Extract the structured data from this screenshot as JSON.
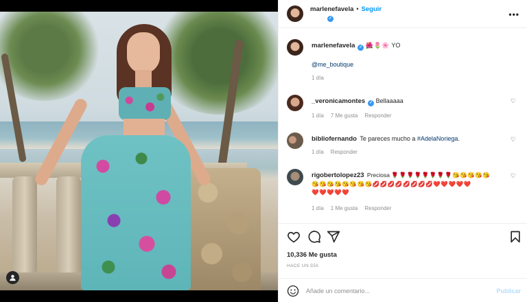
{
  "post": {
    "author": "marlenefavela",
    "follow_label": "Seguir",
    "dot": "•",
    "more": "•••"
  },
  "caption": {
    "user": "marlenefavela",
    "emojis": "🌺🌷🌸",
    "text": "YO",
    "mention": "@me_boutique",
    "time": "1 día"
  },
  "comments": [
    {
      "user": "_veronicamontes",
      "verified": true,
      "text": "Bellaaaaa",
      "time": "1 día",
      "likes": "7 Me gusta",
      "reply": "Responder"
    },
    {
      "user": "bibliofernando",
      "verified": false,
      "text": "Te pareces mucho a ",
      "hashtag": "#AdelaNoriega",
      "end": ".",
      "time": "1 día",
      "reply": "Responder"
    },
    {
      "user": "rigobertolopez23",
      "verified": false,
      "text": "Preciosa",
      "emojis_line1": "🌹🌹🌹🌹🌹🌹🌹🌹😘😘😘😘😘",
      "emojis_line2": "😘😘😘😘😘😘😘😘💋💋💋💋💋💋💋💋❤️❤️❤️❤️❤️",
      "emojis_line3": "❤️❤️❤️❤️❤️",
      "time": "1 día",
      "likes": "1 Me gusta",
      "reply": "Responder"
    }
  ],
  "stats": {
    "likes": "10,336 Me gusta",
    "time": "HACE UN DÍA"
  },
  "composer": {
    "placeholder": "Añade un comentario...",
    "publish": "Publicar"
  },
  "icons": {
    "like": "heart-icon",
    "comment": "comment-icon",
    "share": "share-icon",
    "save": "bookmark-icon",
    "emoji": "emoji-icon",
    "tagged_user": "user-tag-icon",
    "verified": "verified-badge-icon"
  },
  "colors": {
    "accent": "#0095f6",
    "verified": "#3897f0",
    "muted": "#8e8e8e",
    "publish_disabled": "#b2dffc"
  }
}
